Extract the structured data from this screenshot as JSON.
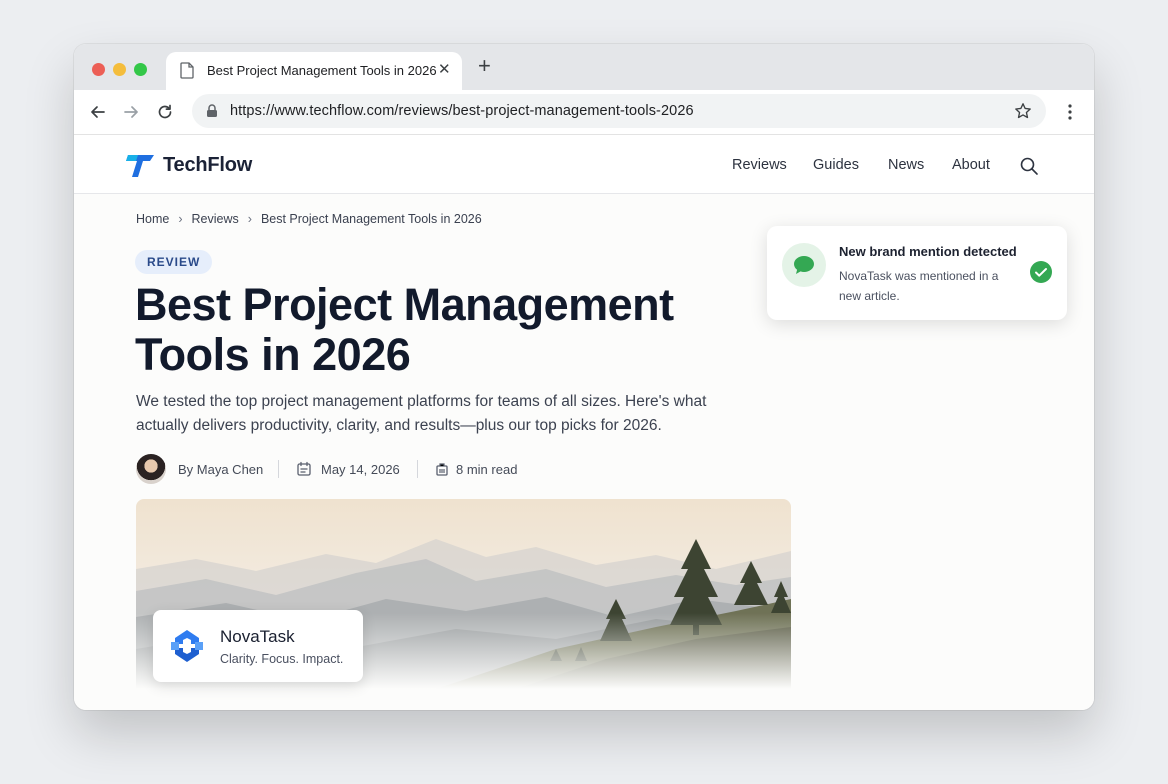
{
  "browser": {
    "tab_title": "Best Project Management Tools in 2026",
    "url": "https://www.techflow.com/reviews/best-project-management-tools-2026"
  },
  "site": {
    "brand": "TechFlow",
    "nav": [
      "Reviews",
      "Guides",
      "News",
      "About"
    ]
  },
  "article": {
    "breadcrumb": [
      "Home",
      "Reviews",
      "Best Project Management Tools in 2026"
    ],
    "badge": "REVIEW",
    "title": "Best Project Management Tools in 2026",
    "dek": "We tested the top project management platforms for teams of all sizes. Here's what actually delivers productivity, clarity, and results—plus our top picks for 2026.",
    "author": "By Maya Chen",
    "date": "May 14, 2026",
    "read_time": "8 min read"
  },
  "featured_brand": {
    "name": "NovaTask",
    "tagline": "Clarity. Focus. Impact."
  },
  "notification": {
    "title": "New brand mention detected",
    "body": "NovaTask was mentioned in a new article."
  },
  "colors": {
    "brand_blue": "#1f6fe0",
    "success_green": "#34a853",
    "badge_bg": "#e6eefb"
  },
  "icons": [
    "document-icon",
    "close-icon",
    "plus-icon",
    "back-arrow-icon",
    "forward-arrow-icon",
    "reload-icon",
    "lock-icon",
    "star-icon",
    "more-vert-icon",
    "search-icon",
    "calendar-icon",
    "clock-icon",
    "chat-bubble-icon",
    "check-circle-icon"
  ]
}
